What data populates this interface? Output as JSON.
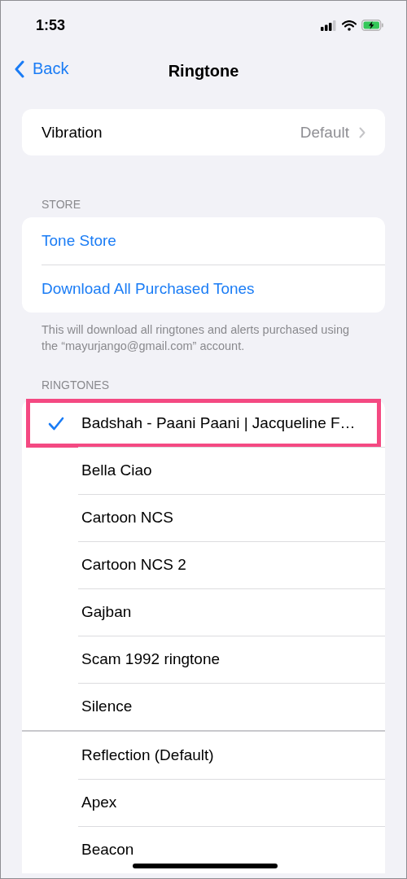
{
  "status_bar": {
    "time": "1:53",
    "charging": true
  },
  "nav": {
    "back": "Back",
    "title": "Ringtone"
  },
  "vibration": {
    "label": "Vibration",
    "value": "Default"
  },
  "store": {
    "header": "STORE",
    "links": [
      "Tone Store",
      "Download All Purchased Tones"
    ],
    "footer": "This will download all ringtones and alerts purchased using the “mayurjango@gmail.com” account."
  },
  "ringtones": {
    "header": "RINGTONES",
    "groups": [
      {
        "items": [
          {
            "name": "Badshah - Paani Paani | Jacqueline F…",
            "selected": true,
            "highlighted": true
          },
          {
            "name": "Bella Ciao",
            "selected": false,
            "highlighted": false
          },
          {
            "name": "Cartoon NCS",
            "selected": false,
            "highlighted": false
          },
          {
            "name": "Cartoon NCS 2",
            "selected": false,
            "highlighted": false
          },
          {
            "name": "Gajban",
            "selected": false,
            "highlighted": false
          },
          {
            "name": "Scam 1992 ringtone",
            "selected": false,
            "highlighted": false
          },
          {
            "name": "Silence",
            "selected": false,
            "highlighted": false
          }
        ]
      },
      {
        "items": [
          {
            "name": "Reflection (Default)",
            "selected": false,
            "highlighted": false
          },
          {
            "name": "Apex",
            "selected": false,
            "highlighted": false
          },
          {
            "name": "Beacon",
            "selected": false,
            "highlighted": false
          }
        ]
      }
    ]
  }
}
